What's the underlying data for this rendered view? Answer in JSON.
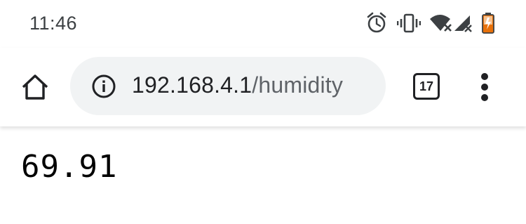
{
  "status_bar": {
    "time": "11:46",
    "icons": [
      "alarm-icon",
      "vibrate-icon",
      "wifi-off-icon",
      "signal-off-icon",
      "battery-icon"
    ]
  },
  "toolbar": {
    "url_host": "192.168.4.1",
    "url_path": "/humidity",
    "tab_count": "17"
  },
  "page": {
    "body_text": "69.91"
  },
  "colors": {
    "omnibox_bg": "#f1f3f4",
    "battery_accent": "#e8710a"
  }
}
